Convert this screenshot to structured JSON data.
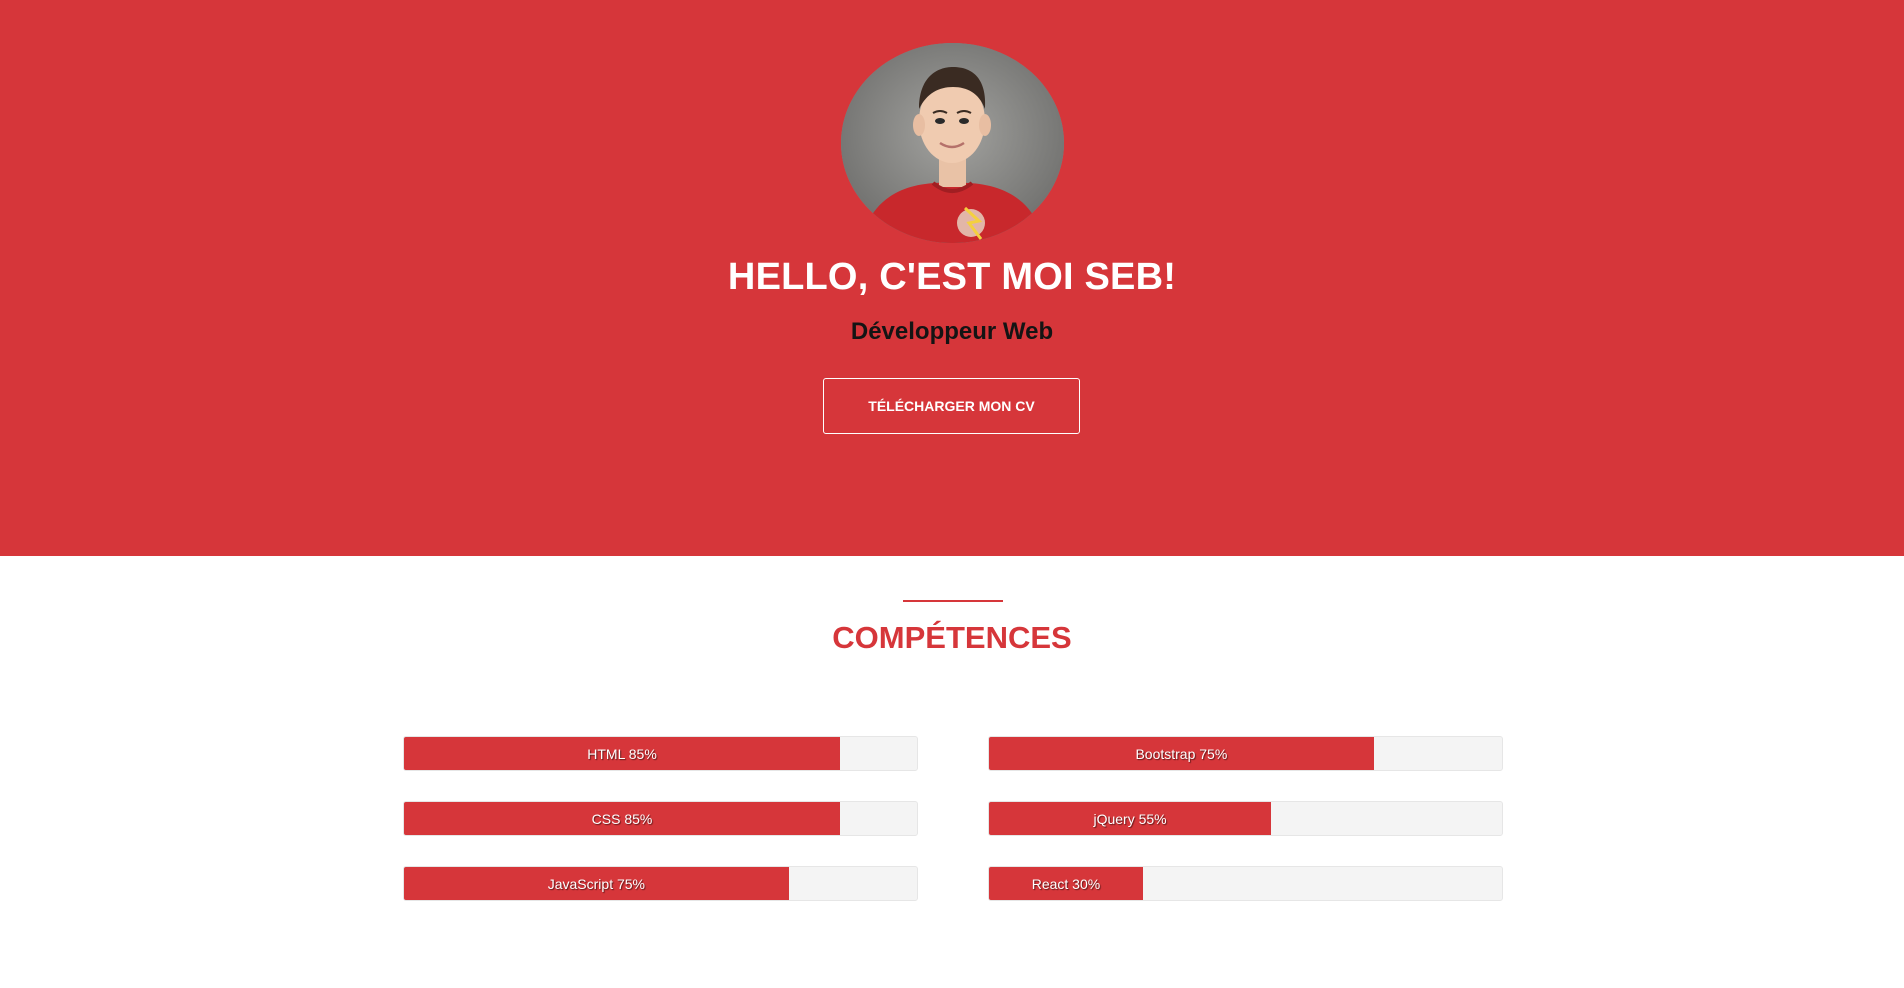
{
  "hero": {
    "title": "HELLO, C'EST MOI SEB!",
    "subtitle": "Développeur Web",
    "cv_button_label": "TÉLÉCHARGER MON CV",
    "avatar_icon": "profile-photo"
  },
  "skills_section": {
    "title": "COMPÉTENCES",
    "left": [
      {
        "label": "HTML 85%",
        "percent": 85
      },
      {
        "label": "CSS 85%",
        "percent": 85
      },
      {
        "label": "JavaScript 75%",
        "percent": 75
      }
    ],
    "right": [
      {
        "label": "Bootstrap 75%",
        "percent": 75
      },
      {
        "label": "jQuery 55%",
        "percent": 55
      },
      {
        "label": "React 30%",
        "percent": 30
      }
    ]
  },
  "colors": {
    "accent": "#d6363a",
    "bar_track": "#f4f4f4",
    "hero_text": "#ffffff",
    "subtitle_text": "#141414"
  }
}
